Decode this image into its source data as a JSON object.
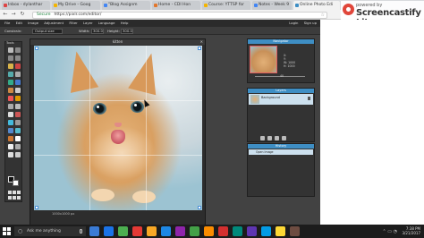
{
  "browser": {
    "tabs": [
      {
        "title": "Inbox - dylanthar"
      },
      {
        "title": "My Drive - Goog"
      },
      {
        "title": "\"Blog Assignm"
      },
      {
        "title": "Home - CDI Hon"
      },
      {
        "title": "Course: YTTSP for"
      },
      {
        "title": "Notes - Week 9"
      },
      {
        "title": "Online Photo Edi"
      }
    ],
    "address": {
      "secure_label": "Secure",
      "url": "https://pixlr.com/editor/"
    }
  },
  "watermark": {
    "small": "powered by",
    "big": "Screencastify Lite"
  },
  "pixlr": {
    "menu": [
      "File",
      "Edit",
      "Image",
      "Adjustment",
      "Filter",
      "Layer",
      "Language",
      "Help"
    ],
    "menu_right": [
      "Login",
      "Sign up"
    ],
    "options": {
      "constrain_label": "Constrain:",
      "constrain_value": "Output size",
      "width_label": "Width:",
      "width_value": "300.0",
      "height_label": "Height:",
      "height_value": "300.0"
    },
    "tools_title": "Tools",
    "canvas": {
      "title": "kitten",
      "status": "1000x1000 px",
      "zoom": "100"
    },
    "navigator": {
      "title": "Navigator",
      "x_label": "X:",
      "y_label": "Y:",
      "w_label": "W:",
      "h_label": "H:",
      "x_val": "",
      "y_val": "",
      "w_val": "1000",
      "h_val": "1000",
      "zoom_val": "40"
    },
    "layers": {
      "title": "Layers",
      "layer_name": "Background"
    },
    "history": {
      "title": "History",
      "item": "Open Image"
    }
  },
  "taskbar": {
    "search_placeholder": "Ask me anything",
    "time": "7:38 PM",
    "date": "3/21/2017",
    "icon_colors": [
      "#3a7bd5",
      "#1a73e8",
      "#4caf50",
      "#e53935",
      "#f9a825",
      "#1e88e5",
      "#8e24aa",
      "#43a047",
      "#fb8c00",
      "#d32f2f",
      "#00897b",
      "#5e35b1",
      "#039be5",
      "#fdd835",
      "#6d4c41"
    ]
  }
}
